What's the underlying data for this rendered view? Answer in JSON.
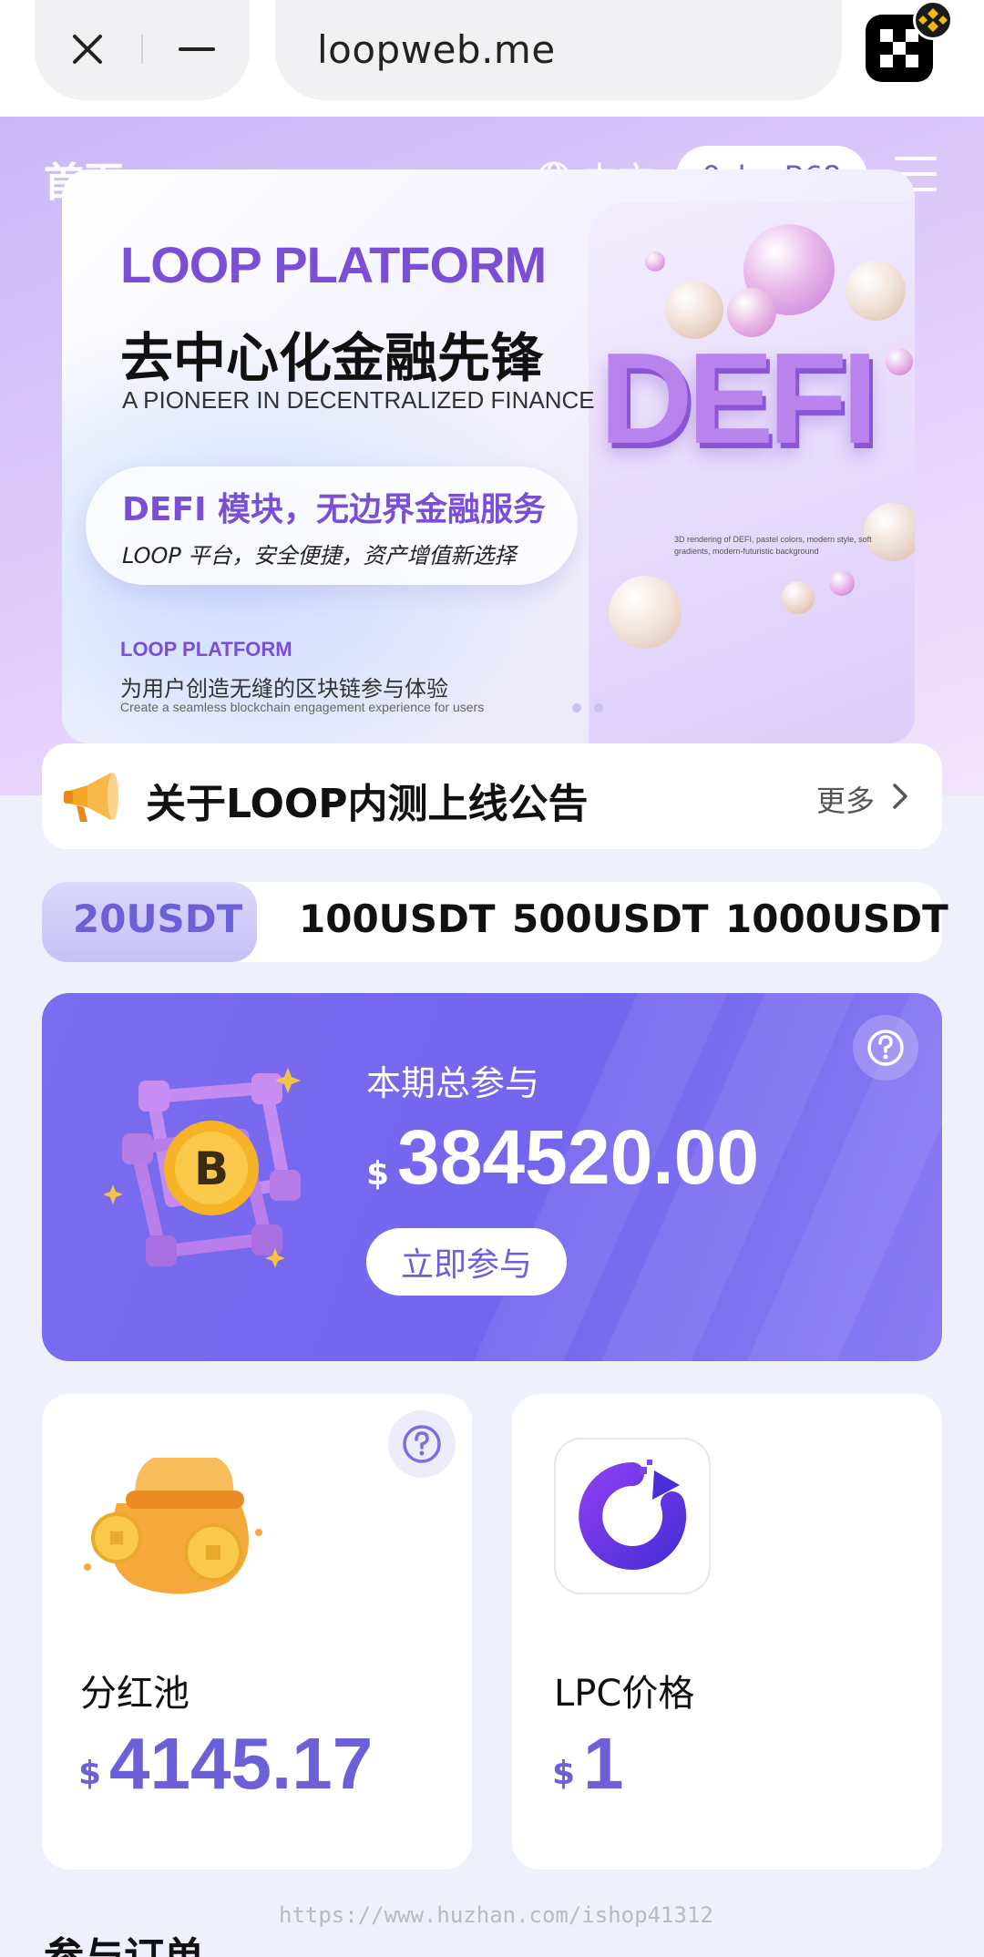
{
  "browser": {
    "url": "loopweb.me"
  },
  "header": {
    "title": "首页",
    "language": "中文",
    "wallet": "0xb...B68"
  },
  "banner": {
    "title_en": "LOOP PLATFORM",
    "title_cn": "去中心化金融先锋",
    "subtitle_en": "A PIONEER IN DECENTRALIZED FINANCE",
    "pill_title": "DEFI 模块，无边界金融服务",
    "pill_subtitle": "LOOP 平台，安全便捷，资产增值新选择",
    "footer_en": "LOOP PLATFORM",
    "footer_cn": "为用户创造无缝的区块链参与体验",
    "footer_small": "Create a seamless blockchain engagement experience for users",
    "graphic_text": "DEFI",
    "graphic_caption": "3D rendering of DEFI, pastel colors, modern style, soft gradients, modern-futuristic background"
  },
  "notice": {
    "text": "关于LOOP内测上线公告",
    "more": "更多"
  },
  "tabs": [
    {
      "label": "20USDT",
      "active": true
    },
    {
      "label": "100USDT",
      "active": false
    },
    {
      "label": "500USDT",
      "active": false
    },
    {
      "label": "1000USDT",
      "active": false
    }
  ],
  "stake": {
    "label": "本期总参与",
    "currency": "$",
    "amount": "384520.00",
    "button": "立即参与"
  },
  "cards": {
    "dividend": {
      "label": "分红池",
      "currency": "$",
      "value": "4145.17"
    },
    "lpc": {
      "label": "LPC价格",
      "currency": "$",
      "value": "1"
    }
  },
  "section": {
    "title": "参与订单"
  },
  "watermark": "https://www.huzhan.com/ishop41312",
  "colors": {
    "accent": "#7465ee",
    "accent_text": "#6b60d8",
    "page_bg": "#eef0fb",
    "hero_bg": "#d9c7fb"
  },
  "icons": [
    "close-icon",
    "minimize-icon",
    "app-icon",
    "globe-icon",
    "menu-icon",
    "megaphone-icon",
    "chevron-right-icon",
    "help-icon",
    "bitcoin-cube-icon",
    "money-bag-icon",
    "lpc-logo-icon"
  ]
}
